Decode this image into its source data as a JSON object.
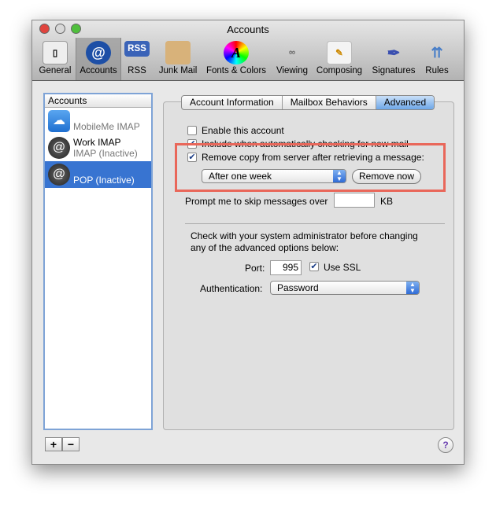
{
  "window": {
    "title": "Accounts"
  },
  "toolbar": [
    {
      "label": "General",
      "icon": "switch-icon"
    },
    {
      "label": "Accounts",
      "icon": "at-icon",
      "selected": true
    },
    {
      "label": "RSS",
      "icon": "rss-icon"
    },
    {
      "label": "Junk Mail",
      "icon": "junk-mail-icon"
    },
    {
      "label": "Fonts & Colors",
      "icon": "fonts-colors-icon"
    },
    {
      "label": "Viewing",
      "icon": "glasses-icon"
    },
    {
      "label": "Composing",
      "icon": "pencil-icon"
    },
    {
      "label": "Signatures",
      "icon": "pen-icon"
    },
    {
      "label": "Rules",
      "icon": "rules-icon"
    }
  ],
  "accounts": {
    "header": "Accounts",
    "items": [
      {
        "name": "",
        "type": "MobileMe IMAP",
        "icon": "cloud-icon"
      },
      {
        "name": "Work IMAP",
        "type": "IMAP (Inactive)",
        "icon": "at-icon"
      },
      {
        "name": "",
        "type": "POP (Inactive)",
        "icon": "at-icon",
        "selected": true
      }
    ],
    "add": "+",
    "remove": "−"
  },
  "tabs": [
    "Account Information",
    "Mailbox Behaviors",
    "Advanced"
  ],
  "advanced": {
    "enable": {
      "label": "Enable this account",
      "checked": false
    },
    "include": {
      "label": "Include when automatically checking for new mail",
      "checked": true
    },
    "remove_copy": {
      "label": "Remove copy from server after retrieving a message:",
      "checked": true
    },
    "remove_when": "After one week",
    "remove_now": "Remove now",
    "prompt_label": "Prompt me to skip messages over",
    "prompt_value": "",
    "prompt_unit": "KB",
    "admin_note": "Check with your system administrator before changing any of the advanced options below:",
    "port_label": "Port:",
    "port": "995",
    "ssl": {
      "label": "Use SSL",
      "checked": true
    },
    "auth_label": "Authentication:",
    "auth": "Password"
  },
  "help": "?",
  "colors": {
    "highlight": "#e9675a",
    "selection": "#3874d1"
  }
}
